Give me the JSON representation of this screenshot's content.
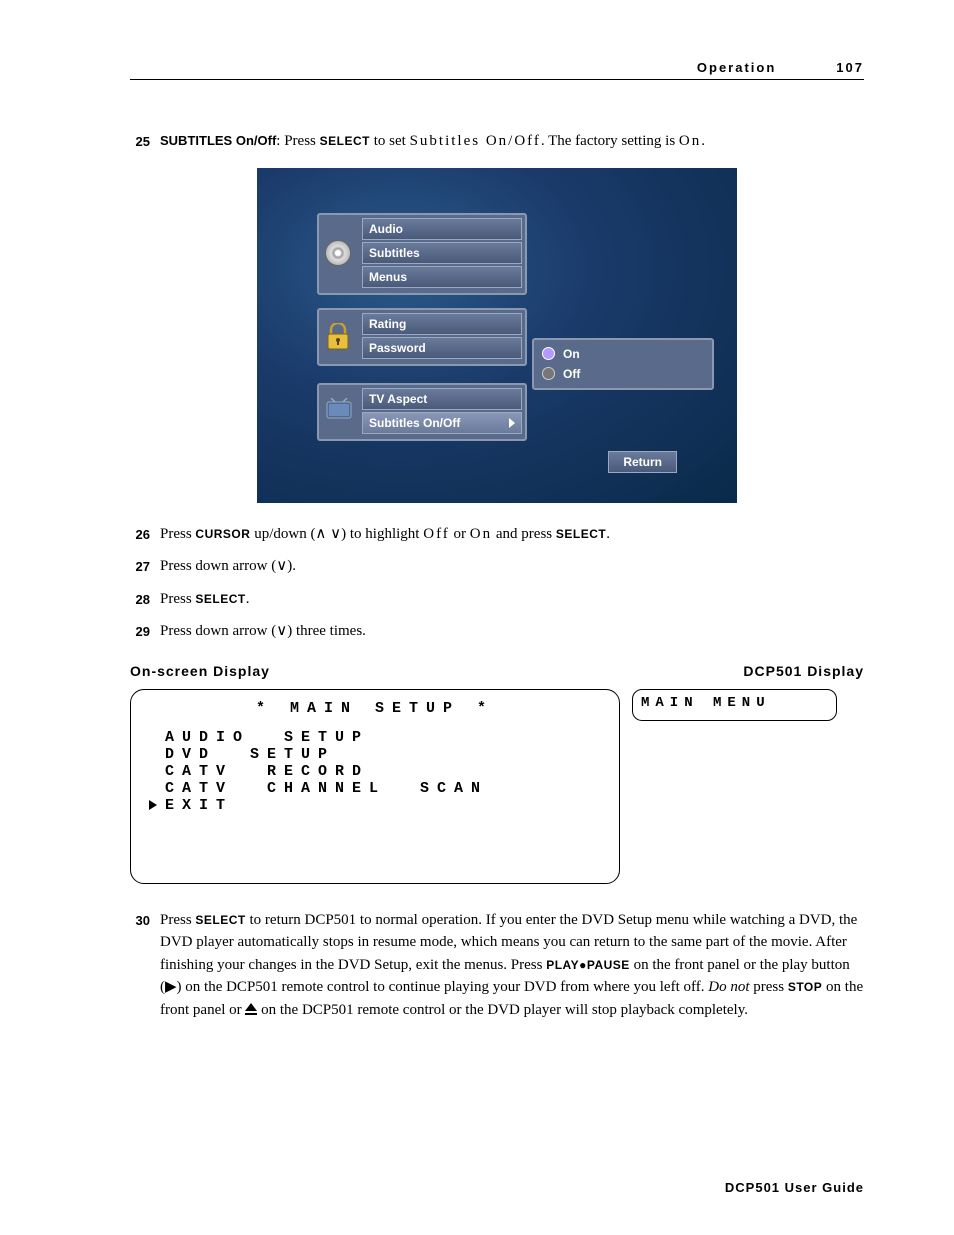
{
  "header": {
    "section": "Operation",
    "page": "107"
  },
  "steps": {
    "s25": {
      "num": "25",
      "label_bold": "SUBTITLES On/Off",
      "t1": ": Press ",
      "kw1": "SELECT",
      "t2": " to set ",
      "spaced1": "Subtitles On/Off",
      "t3": ". The factory setting is ",
      "spaced2": "On",
      "t4": "."
    },
    "s26": {
      "num": "26",
      "t1": "Press ",
      "kw1": "CURSOR",
      "t2": " up/down (∧ ∨) to highlight ",
      "spaced1": "Off",
      "t3": " or ",
      "spaced2": "On",
      "t4": " and press ",
      "kw2": "SELECT",
      "t5": "."
    },
    "s27": {
      "num": "27",
      "text": "Press down arrow (∨)."
    },
    "s28": {
      "num": "28",
      "t1": "Press ",
      "kw1": "SELECT",
      "t2": "."
    },
    "s29": {
      "num": "29",
      "text": "Press down arrow (∨) three times."
    },
    "s30": {
      "num": "30",
      "t1": "Press ",
      "kw1": "SELECT",
      "t2": " to return DCP501 to normal operation. If you enter the DVD Setup menu while watching a DVD, the DVD player automatically stops in resume mode, which means you can return to the same part of the movie. After finishing your changes in the DVD Setup, exit the menus. Press ",
      "kw2": "PLAY●PAUSE",
      "t3": " on the front panel or the play button (▶) on the DCP501 remote control to continue playing your DVD from where you left off. ",
      "em": "Do not",
      "t4": " press ",
      "kw3": "STOP",
      "t5": " on the front panel or ",
      "t6": " on the DCP501 remote control or the DVD player will stop playback completely."
    }
  },
  "osd": {
    "group1": [
      "Audio",
      "Subtitles",
      "Menus"
    ],
    "group2": [
      "Rating",
      "Password"
    ],
    "group3": [
      "TV Aspect",
      "Subtitles On/Off"
    ],
    "submenu": {
      "opt1": "On",
      "opt2": "Off"
    },
    "return": "Return"
  },
  "display_labels": {
    "left": "On-screen Display",
    "right": "DCP501 Display"
  },
  "lcd_left": {
    "title": "*  MAIN  SETUP  *",
    "rows": [
      {
        "text": "AUDIO  SETUP",
        "sel": false
      },
      {
        "text": "DVD  SETUP",
        "sel": false
      },
      {
        "text": "CATV  RECORD",
        "sel": false
      },
      {
        "text": "CATV  CHANNEL  SCAN",
        "sel": false
      },
      {
        "text": "EXIT",
        "sel": true
      }
    ]
  },
  "lcd_right": {
    "text": "MAIN MENU"
  },
  "footer": "DCP501 User Guide"
}
